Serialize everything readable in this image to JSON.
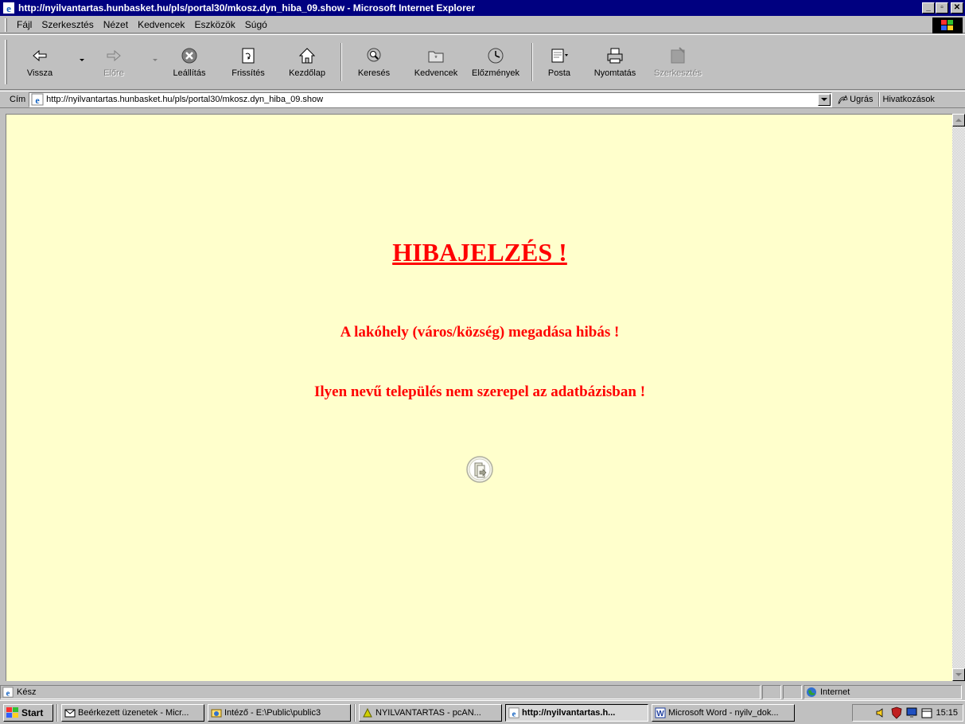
{
  "window": {
    "title": "http://nyilvantartas.hunbasket.hu/pls/portal30/mkosz.dyn_hiba_09.show - Microsoft Internet Explorer",
    "minimize": "_",
    "maximize": "▫",
    "close": "✕"
  },
  "menu": {
    "items": [
      "Fájl",
      "Szerkesztés",
      "Nézet",
      "Kedvencek",
      "Eszközök",
      "Súgó"
    ]
  },
  "toolbar": {
    "back": "Vissza",
    "forward": "Előre",
    "stop": "Leállítás",
    "refresh": "Frissítés",
    "home": "Kezdőlap",
    "search": "Keresés",
    "favorites": "Kedvencek",
    "history": "Előzmények",
    "mail": "Posta",
    "print": "Nyomtatás",
    "edit": "Szerkesztés"
  },
  "address": {
    "label": "Cím",
    "url": "http://nyilvantartas.hunbasket.hu/pls/portal30/mkosz.dyn_hiba_09.show",
    "go": "Ugrás",
    "links": "Hivatkozások"
  },
  "page": {
    "heading": "HIBAJELZÉS !",
    "message1": "A lakóhely (város/község) megadása hibás !",
    "message2": "Ilyen nevű település nem szerepel az adatbázisban !",
    "background": "#ffffcc",
    "accent": "#ff0000"
  },
  "status": {
    "text": "Kész",
    "zone": "Internet"
  },
  "taskbar": {
    "start": "Start",
    "tasks": [
      "Beérkezett üzenetek - Micr...",
      "Intéző - E:\\Public\\public3",
      "NYILVANTARTAS - pcAN...",
      "http://nyilvantartas.h...",
      "Microsoft Word - nyilv_dok..."
    ],
    "clock": "15:15"
  }
}
